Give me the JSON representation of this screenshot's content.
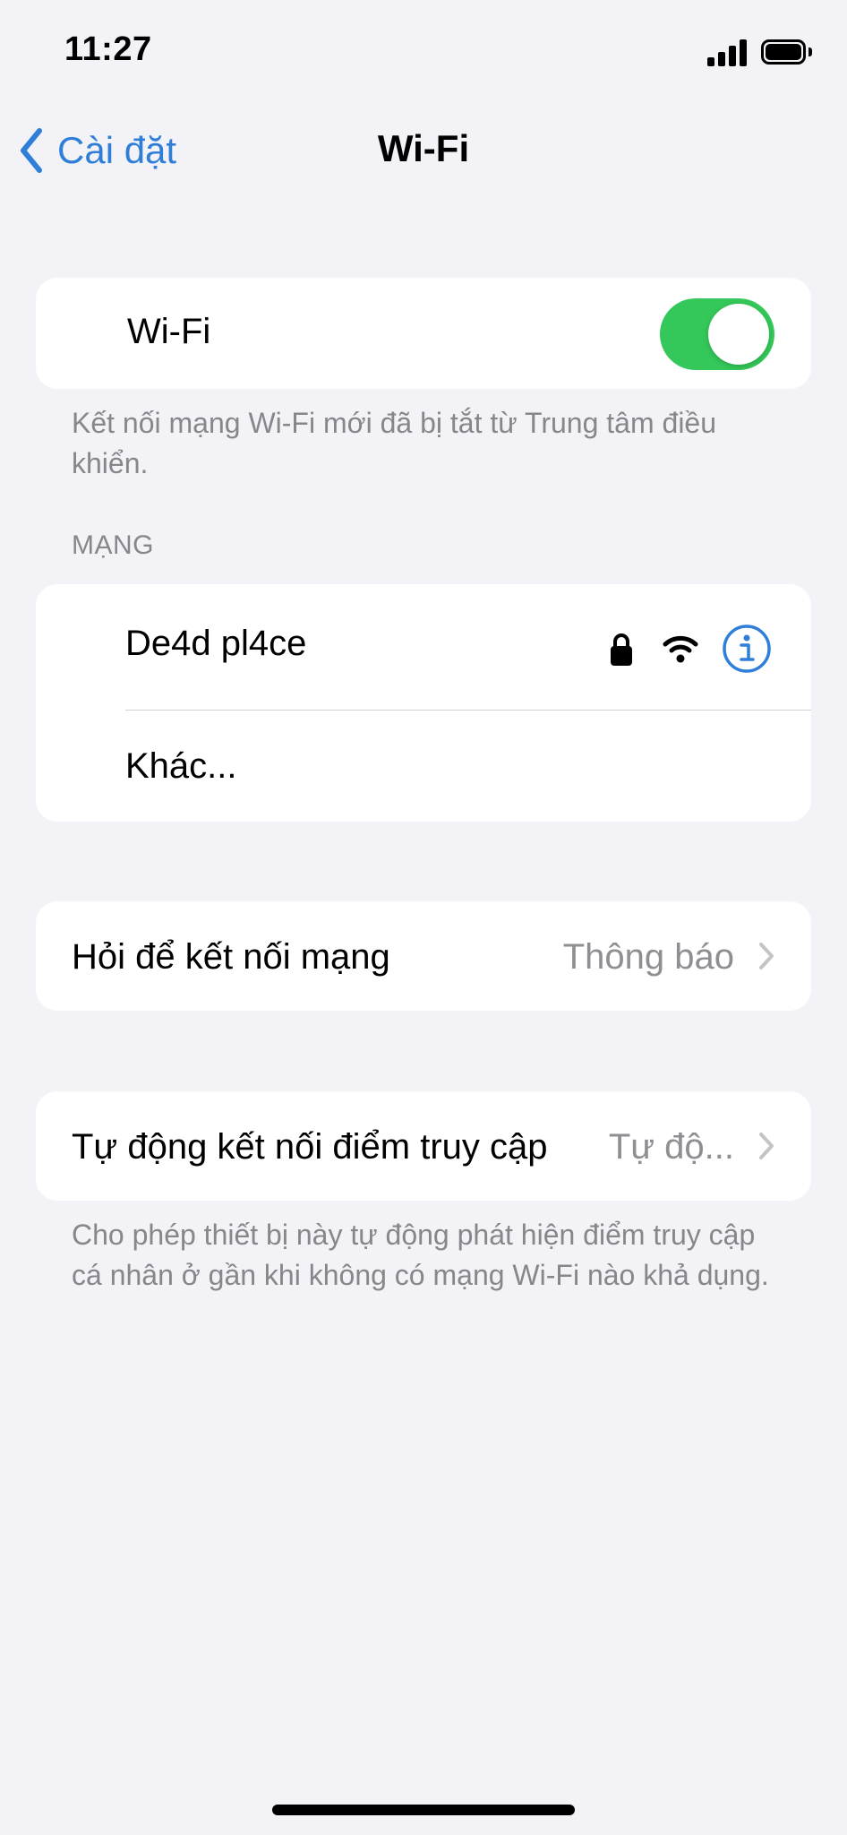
{
  "status_bar": {
    "time": "11:27",
    "signal_icon": "cellular-signal-icon",
    "battery_icon": "battery-icon"
  },
  "nav": {
    "back_label": "Cài đặt",
    "title": "Wi-Fi"
  },
  "wifi": {
    "label": "Wi-Fi",
    "toggle_on": true,
    "note": "Kết nối mạng Wi-Fi mới đã bị tắt từ Trung tâm điều khiển."
  },
  "networks": {
    "header": "MẠNG",
    "items": [
      {
        "name": "De4d pl4ce",
        "secured": true,
        "icons": [
          "lock-icon",
          "wifi-signal-icon",
          "info-icon"
        ]
      },
      {
        "name": "Khác..."
      }
    ]
  },
  "ask_to_join": {
    "label": "Hỏi để kết nối mạng",
    "value": "Thông báo"
  },
  "auto_join_hotspot": {
    "label": "Tự động kết nối điểm truy cập",
    "value": "Tự độ...",
    "note": "Cho phép thiết bị này tự động phát hiện điểm truy cập cá nhân ở gần khi không có mạng Wi-Fi nào khả dụng."
  },
  "colors": {
    "accent": "#2F7FD8",
    "toggle_on": "#34C759",
    "background": "#F2F2F7",
    "secondary_text": "#86868B"
  }
}
